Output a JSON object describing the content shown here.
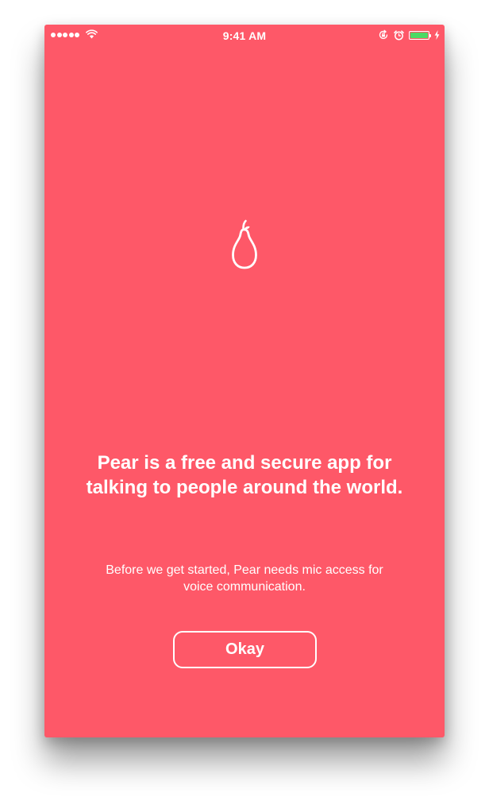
{
  "status_bar": {
    "time": "9:41 AM",
    "signal_bars": 5,
    "battery_level": 1.0,
    "battery_color": "#4cd964",
    "icons": [
      "wifi-icon",
      "rotation-lock-icon",
      "alarm-icon",
      "battery-icon",
      "charging-bolt-icon"
    ]
  },
  "screen": {
    "background_color": "#fe5868",
    "logo_icon": "pear-icon",
    "headline": "Pear is a free and secure app for talking to people around the world.",
    "subtext": "Before we get started, Pear needs mic access for voice communication.",
    "okay_button_label": "Okay"
  }
}
